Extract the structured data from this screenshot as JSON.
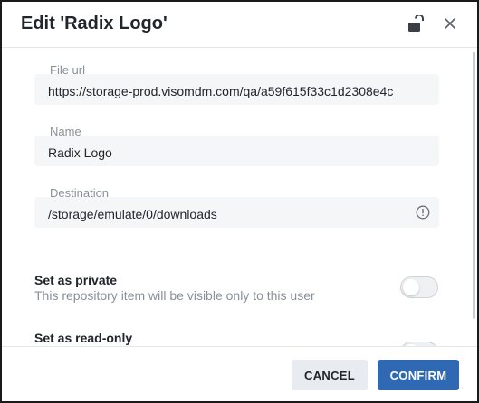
{
  "dialog": {
    "title": "Edit 'Radix Logo'"
  },
  "fields": {
    "file_url": {
      "label": "File url",
      "value": "https://storage-prod.visomdm.com/qa/a59f615f33c1d2308e4c"
    },
    "name": {
      "label": "Name",
      "value": "Radix Logo"
    },
    "destination": {
      "label": "Destination",
      "value": "/storage/emulate/0/downloads"
    }
  },
  "toggles": {
    "private": {
      "title": "Set as private",
      "description": "This repository item will be visible only to this user",
      "on": false
    },
    "read_only": {
      "title": "Set as read-only",
      "on": false
    }
  },
  "footer": {
    "cancel_label": "CANCEL",
    "confirm_label": "CONFIRM"
  },
  "colors": {
    "primary": "#2f69b3",
    "field_bg": "#f4f6f8",
    "muted_text": "#8a9099"
  },
  "icons": {
    "lock": "unlock-icon",
    "close": "close-icon",
    "info": "info-icon"
  }
}
